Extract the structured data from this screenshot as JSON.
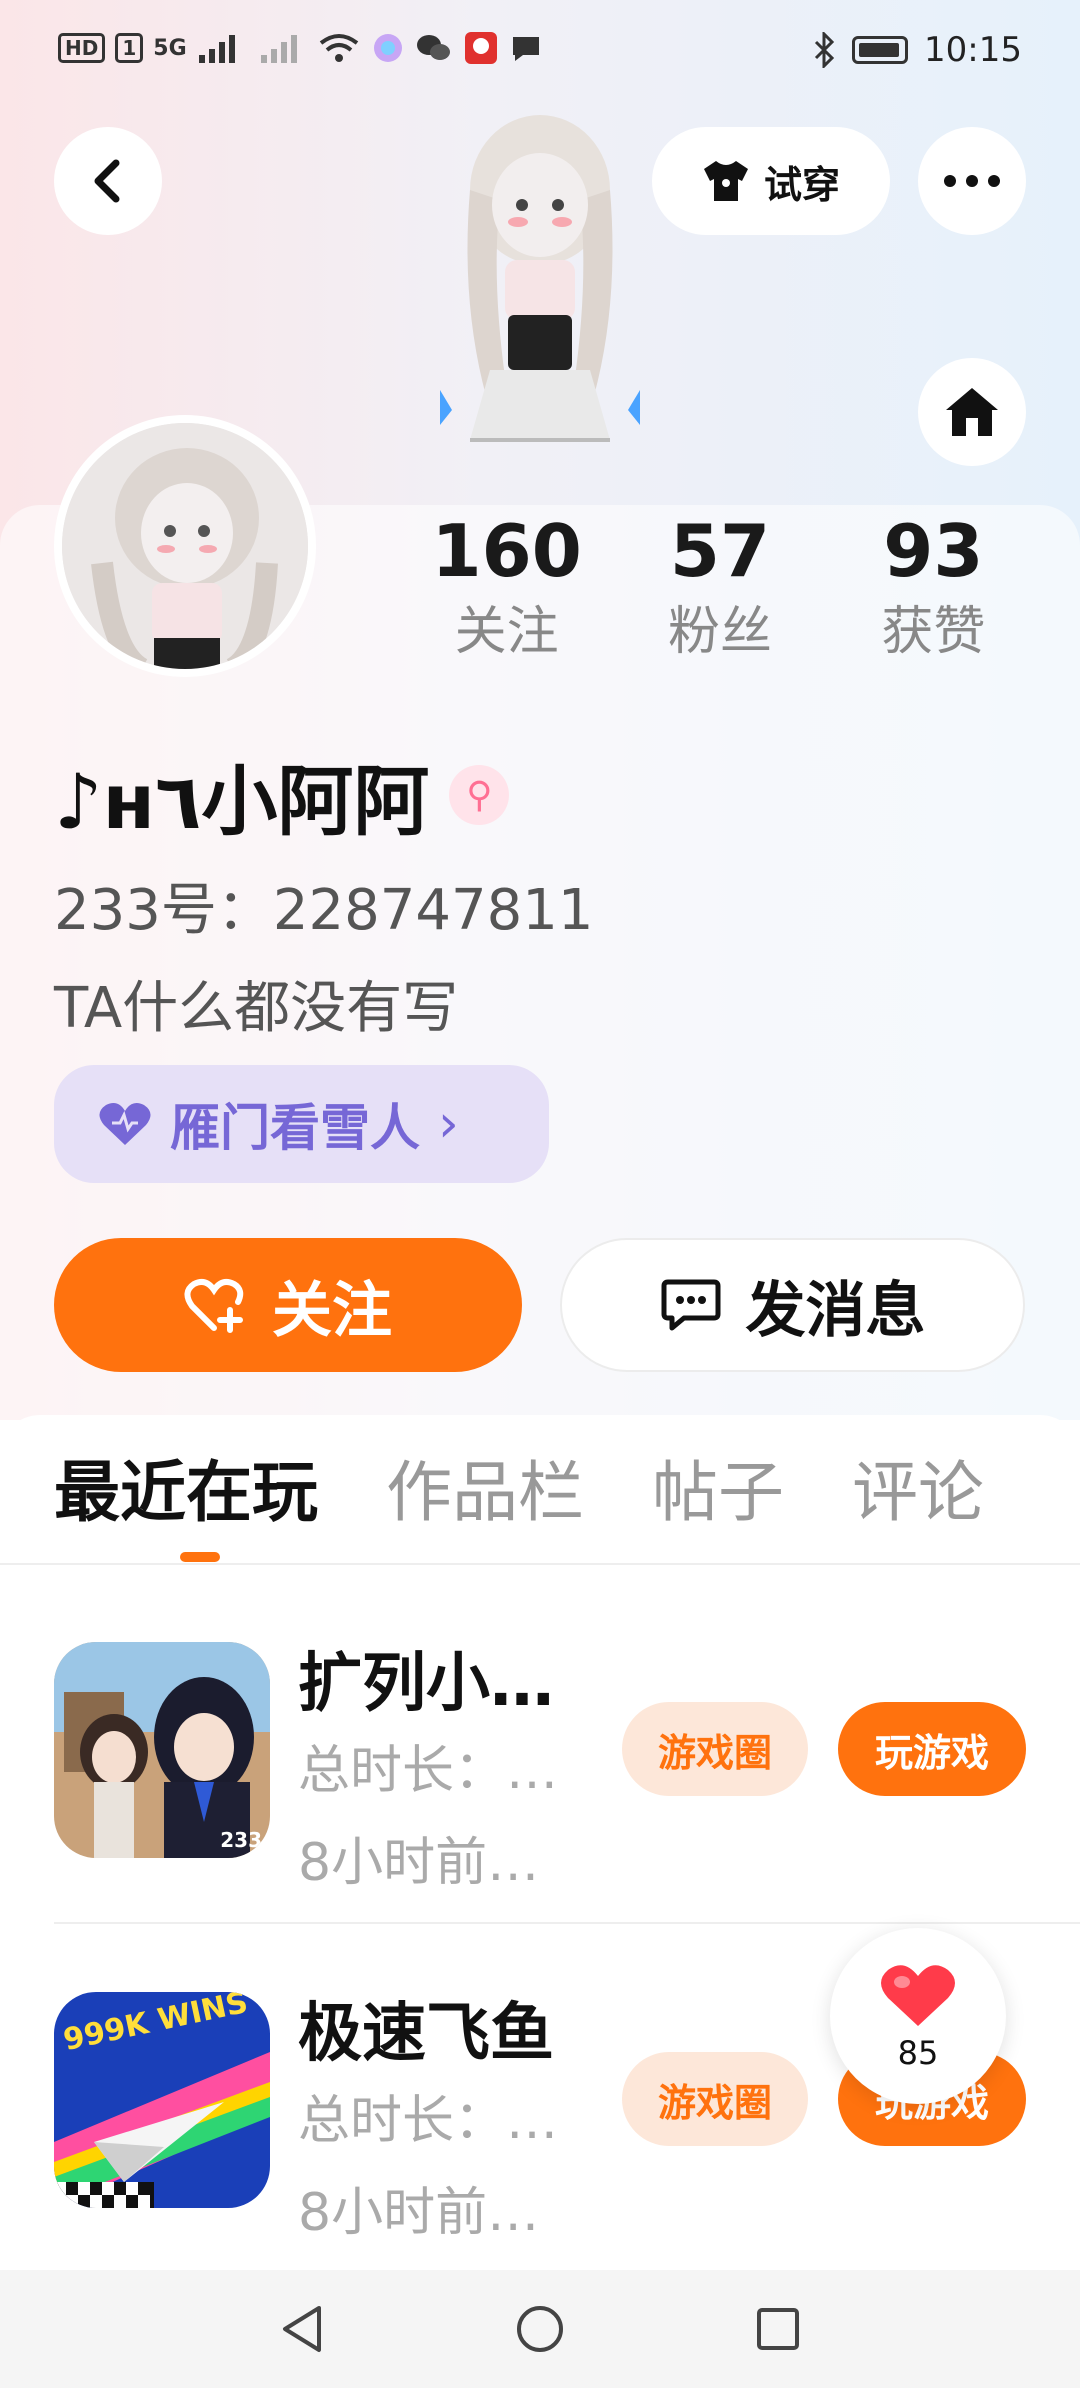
{
  "status_bar": {
    "time": "10:15",
    "hd_label": "HD",
    "sim_label": "1",
    "network_label": "5G"
  },
  "header": {
    "tryon_label": "试穿"
  },
  "profile": {
    "stats": [
      {
        "value": "160",
        "label": "关注"
      },
      {
        "value": "57",
        "label": "粉丝"
      },
      {
        "value": "93",
        "label": "获赞"
      }
    ],
    "username": "♪ʜ٦小阿阿",
    "gender_symbol": "⚲",
    "uid_text": "233号：228747811",
    "bio": "TA什么都没有写",
    "tag_label": "雁门看雪人",
    "tag_chevron": "›",
    "follow_label": "关注",
    "message_label": "发消息"
  },
  "tabs": [
    {
      "label": "最近在玩",
      "active": true
    },
    {
      "label": "作品栏",
      "active": false
    },
    {
      "label": "帖子",
      "active": false
    },
    {
      "label": "评论",
      "active": false
    }
  ],
  "games": [
    {
      "title": "扩列小…",
      "meta_duration": "总时长：…",
      "meta_time": "8小时前…",
      "icon_badge": "233",
      "circle_label": "游戏圈",
      "play_label": "玩游戏"
    },
    {
      "title": "极速飞鱼",
      "meta_duration": "总时长：…",
      "meta_time": "8小时前…",
      "icon_badge": "999K WINS",
      "circle_label": "游戏圈",
      "play_label": "玩游戏"
    }
  ],
  "float_like": {
    "count": "85"
  },
  "colors": {
    "accent": "#ff720e",
    "tag_bg": "#e6e0f7",
    "tag_text": "#7667d6",
    "like_red": "#ff3b4a"
  }
}
